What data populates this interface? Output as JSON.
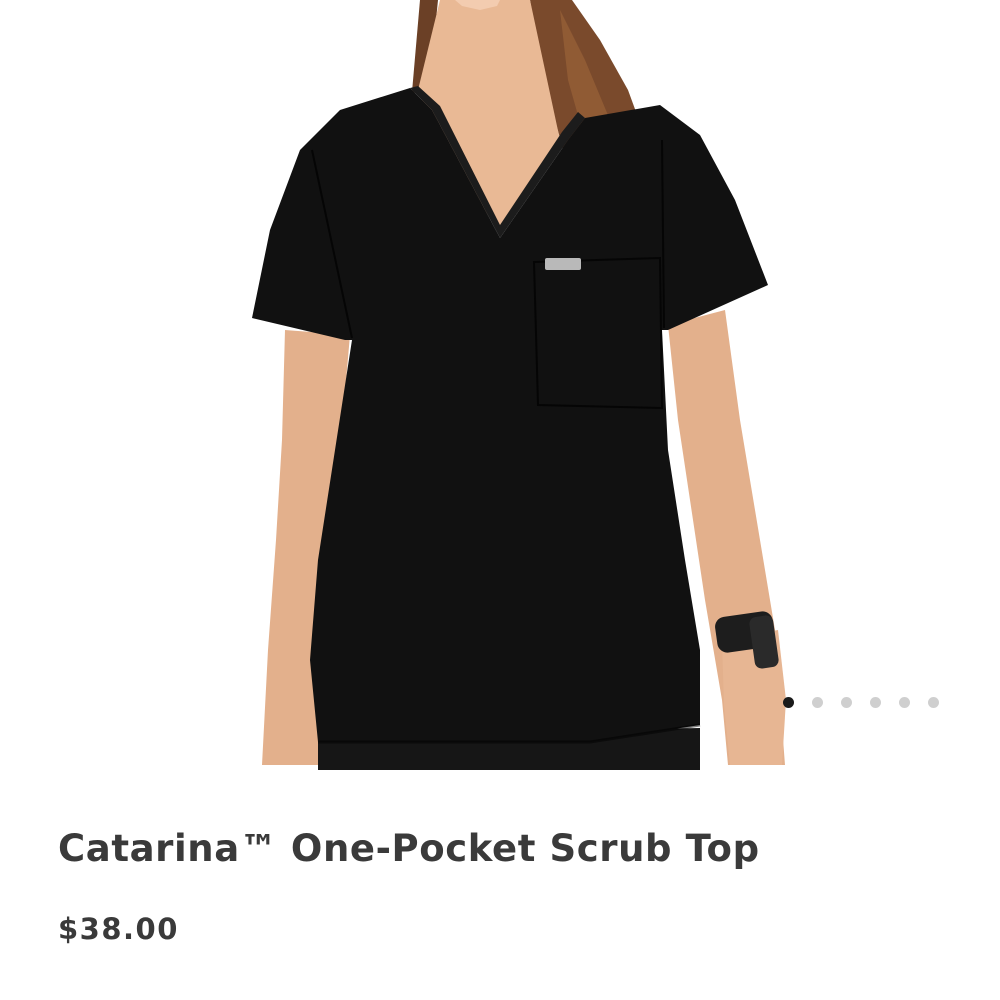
{
  "gallery": {
    "image": "black-v-neck-scrub-top-model-photo",
    "slide_count": 6,
    "active_slide": 1,
    "dot_active_color": "#1a1a1a",
    "dot_inactive_color": "#cfcfcf"
  },
  "product": {
    "title": "Catarina™ One-Pocket Scrub Top",
    "price": "$38.00"
  },
  "colors": {
    "text": "#3a3a3a",
    "garment": "#111111"
  }
}
